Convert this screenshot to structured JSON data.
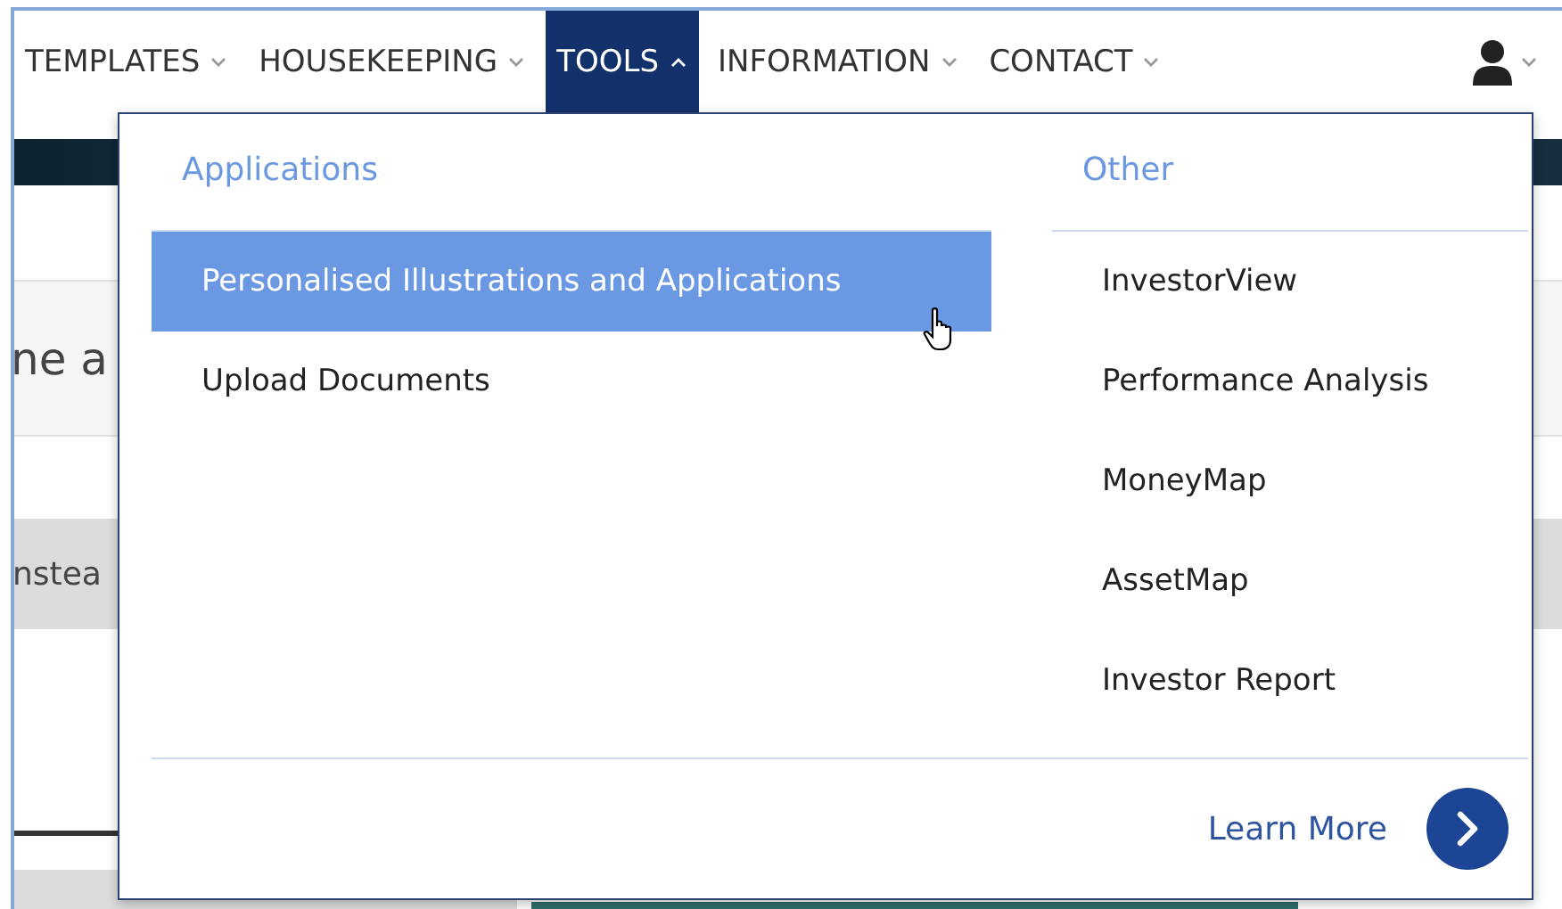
{
  "nav": {
    "items": [
      {
        "label": "TEMPLATES",
        "selected": false
      },
      {
        "label": "HOUSEKEEPING",
        "selected": false
      },
      {
        "label": "TOOLS",
        "selected": true
      },
      {
        "label": "INFORMATION",
        "selected": false
      },
      {
        "label": "CONTACT",
        "selected": false
      }
    ]
  },
  "page_behind": {
    "line_1": "ne a",
    "line_2": "nstea"
  },
  "dropdown": {
    "columns": [
      {
        "heading": "Applications",
        "items": [
          {
            "label": "Personalised Illustrations and Applications",
            "selected": true
          },
          {
            "label": "Upload Documents",
            "selected": false
          }
        ]
      },
      {
        "heading": "Other",
        "items": [
          {
            "label": "InvestorView",
            "selected": false
          },
          {
            "label": "Performance Analysis",
            "selected": false
          },
          {
            "label": "MoneyMap",
            "selected": false
          },
          {
            "label": "AssetMap",
            "selected": false
          },
          {
            "label": "Investor Report",
            "selected": false
          }
        ]
      }
    ],
    "footer_link": "Learn More"
  }
}
